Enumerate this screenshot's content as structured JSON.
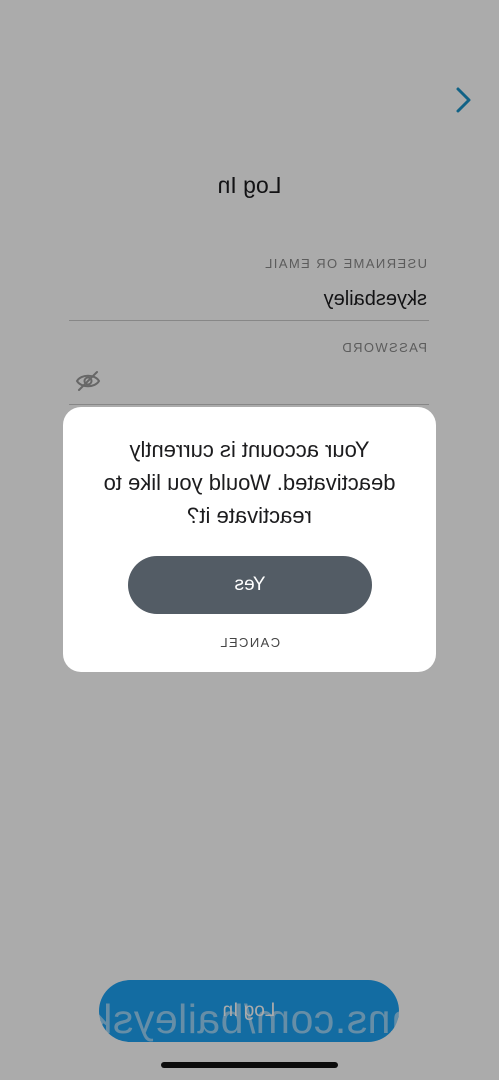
{
  "screen": {
    "title": "Log In",
    "back_icon": "chevron-left-icon"
  },
  "form": {
    "username_label": "USERNAME OR EMAIL",
    "username_value": "skyesbailey",
    "password_label": "PASSWORD",
    "password_value": "",
    "password_toggle_icon": "eye-slash-icon",
    "submit_label": "Log In"
  },
  "dialog": {
    "message": "Your account is currently deactivated. Would you like to reactivate it?",
    "confirm_label": "Yes",
    "cancel_label": "CANCEL"
  },
  "watermark": "Onlyfans.com/baileyskyes-f",
  "colors": {
    "accent": "#1da1f2",
    "back_icon": "#1a93c8",
    "confirm_button": "#535c65",
    "overlay": "rgba(0,0,0,0.33)"
  }
}
